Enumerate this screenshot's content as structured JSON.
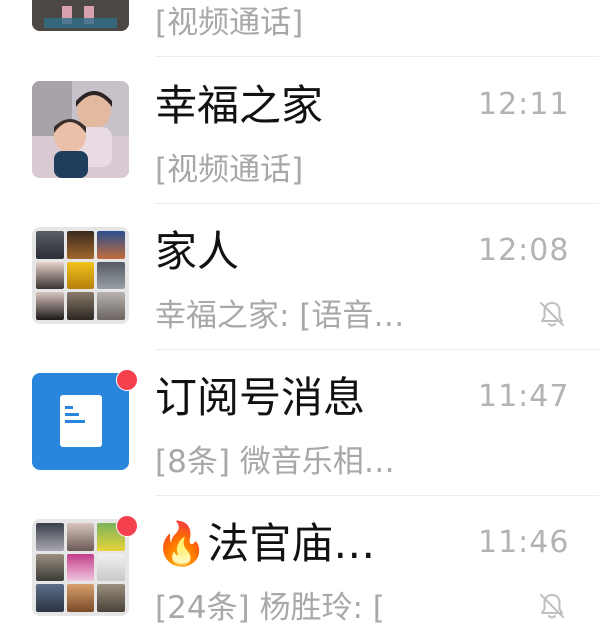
{
  "chats": [
    {
      "name": "",
      "preview": "[视频通话]",
      "time": "",
      "avatar": "photo"
    },
    {
      "name": "幸福之家",
      "preview": "[视频通话]",
      "time": "12:11",
      "avatar": "family-photo"
    },
    {
      "name": "家人",
      "preview": "幸福之家: [语音…",
      "time": "12:08",
      "avatar": "group-grid",
      "muted": true,
      "mute_icon": "bell-off-icon"
    },
    {
      "name": "订阅号消息",
      "preview": "[8条] 微音乐相…",
      "time": "11:47",
      "avatar": "subscription-doc-icon",
      "unread_dot": true,
      "accent": "#2a86dd"
    },
    {
      "name": "法官庙…",
      "emoji": "🔥",
      "preview": "[24条] 杨胜玲: [",
      "time": "11:46",
      "avatar": "group-grid",
      "unread_dot": true,
      "muted": true,
      "mute_icon": "bell-off-icon"
    }
  ],
  "colors": {
    "badge": "#f5414d",
    "time": "#b3b3b3",
    "preview": "#a8a8a8",
    "name": "#111111"
  }
}
